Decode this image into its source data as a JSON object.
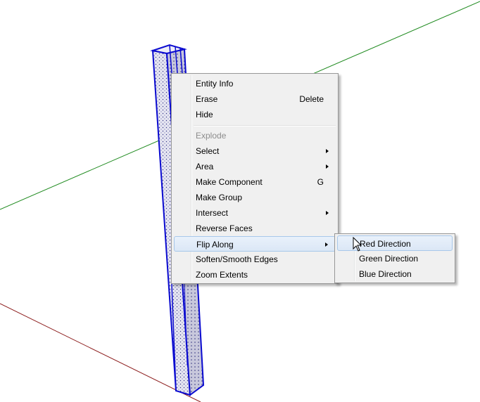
{
  "context_menu": {
    "items": [
      {
        "label": "Entity Info"
      },
      {
        "label": "Erase",
        "shortcut": "Delete"
      },
      {
        "label": "Hide"
      },
      {
        "label": "Explode",
        "disabled": true
      },
      {
        "label": "Select",
        "submenu": true
      },
      {
        "label": "Area",
        "submenu": true
      },
      {
        "label": "Make Component",
        "shortcut": "G"
      },
      {
        "label": "Make Group"
      },
      {
        "label": "Intersect",
        "submenu": true
      },
      {
        "label": "Reverse Faces"
      },
      {
        "label": "Flip Along",
        "submenu": true,
        "highlighted": true
      },
      {
        "label": "Soften/Smooth Edges"
      },
      {
        "label": "Zoom Extents"
      }
    ]
  },
  "submenu": {
    "items": [
      {
        "label": "Red Direction",
        "highlighted": true
      },
      {
        "label": "Green Direction"
      },
      {
        "label": "Blue Direction"
      }
    ]
  },
  "scene": {
    "axis_colors": {
      "red": "#8b1a1a",
      "green": "#1e8a1e"
    },
    "selection_color": "#0a0ad0",
    "face_color": "#d8d8ea",
    "cursor_icon": "arrow-cursor-icon",
    "submenu_arrow_icon": "submenu-arrow-icon"
  }
}
